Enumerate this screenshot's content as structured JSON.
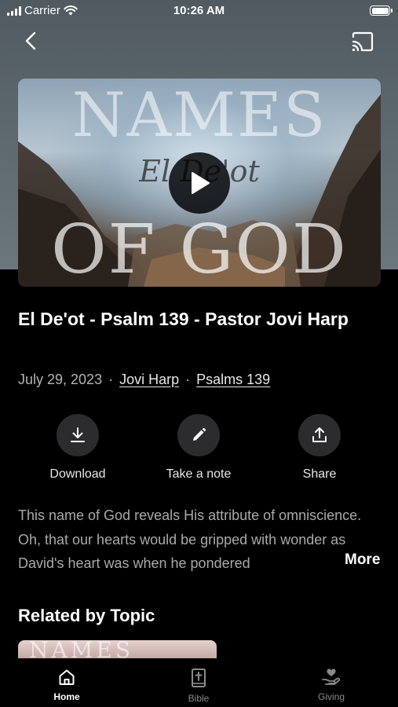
{
  "status_bar": {
    "carrier": "Carrier",
    "time": "10:26 AM"
  },
  "media": {
    "artwork_title_top": "NAMES",
    "artwork_script": "El De'ot",
    "artwork_title_bottom": "OF GOD"
  },
  "sermon": {
    "title": "El De'ot - Psalm 139 - Pastor Jovi Harp",
    "date": "July 29, 2023",
    "speaker": "Jovi Harp",
    "scripture": "Psalms 139",
    "description": "This name of God reveals His attribute of omniscience. Oh, that our hearts would be gripped with wonder as David's heart was when he pondered"
  },
  "actions": {
    "download": "Download",
    "note": "Take a note",
    "share": "Share"
  },
  "more_label": "More",
  "related": {
    "heading": "Related by Topic",
    "thumb_text": "NAMES"
  },
  "tabs": [
    {
      "label": "Home",
      "icon": "home-icon",
      "active": true
    },
    {
      "label": "Bible",
      "icon": "bible-icon",
      "active": false
    },
    {
      "label": "Giving",
      "icon": "giving-icon",
      "active": false
    }
  ]
}
